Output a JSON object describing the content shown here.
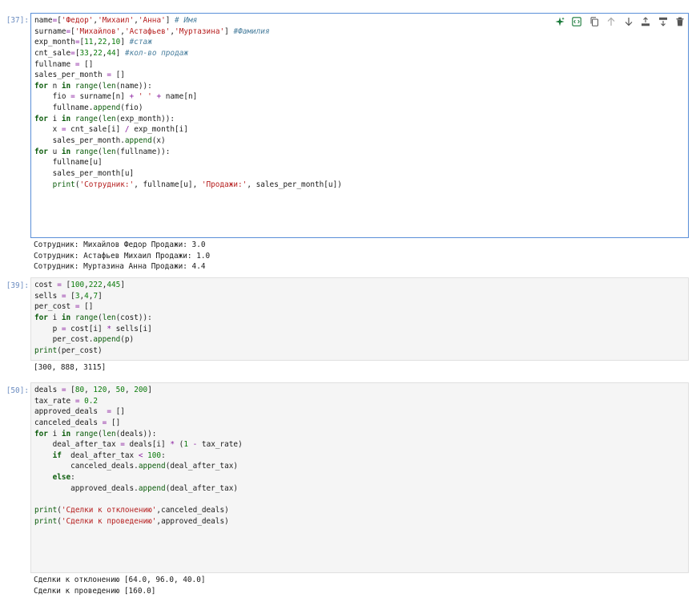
{
  "cells": [
    {
      "prompt": "[37]:",
      "lines": [
        "name=['Федор','Михаил','Анна'] # Имя",
        "surname=['Михайлов','Астафьев','Муртазина'] #Фамилия",
        "exp_month=[11,22,10] #стаж",
        "cnt_sale=[33,22,44] #кол-во продаж",
        "fullname = []",
        "sales_per_month = []",
        "for n in range(len(name)):",
        "    fio = surname[n] + ' ' + name[n]",
        "    fullname.append(fio)",
        "for i in range(len(exp_month)):",
        "    x = cnt_sale[i] / exp_month[i]",
        "    sales_per_month.append(x)",
        "for u in range(len(fullname)):",
        "    fullname[u]",
        "    sales_per_month[u]",
        "    print('Сотрудник:', fullname[u], 'Продажи:', sales_per_month[u])"
      ],
      "output": [
        "Сотрудник: Михайлов Федор Продажи: 3.0",
        "Сотрудник: Астафьев Михаил Продажи: 1.0",
        "Сотрудник: Муртазина Анна Продажи: 4.4"
      ]
    },
    {
      "prompt": "[39]:",
      "lines": [
        "cost = [100,222,445]",
        "sells = [3,4,7]",
        "per_cost = []",
        "for i in range(len(cost)):",
        "    p = cost[i] * sells[i]",
        "    per_cost.append(p)",
        "print(per_cost)"
      ],
      "output": [
        "[300, 888, 3115]"
      ]
    },
    {
      "prompt": "[50]:",
      "lines": [
        "deals = [80, 120, 50, 200]",
        "tax_rate = 0.2",
        "approved_deals  = []",
        "canceled_deals = []",
        "for i in range(len(deals)):",
        "    deal_after_tax = deals[i] * (1 - tax_rate)",
        "    if  deal_after_tax < 100:",
        "        canceled_deals.append(deal_after_tax)",
        "    else:",
        "        approved_deals.append(deal_after_tax)",
        "",
        "print('Сделки к отклонению',canceled_deals)",
        "print('Сделки к проведению',approved_deals)"
      ],
      "output": [
        "Сделки к отклонению [64.0, 96.0, 40.0]",
        "Сделки к проведению [160.0]"
      ]
    }
  ],
  "toolbar_icons": [
    {
      "name": "sparkle-icon"
    },
    {
      "name": "code-icon"
    },
    {
      "name": "copy-icon"
    },
    {
      "name": "arrow-up-icon"
    },
    {
      "name": "arrow-down-icon"
    },
    {
      "name": "insert-above-icon"
    },
    {
      "name": "insert-below-icon"
    },
    {
      "name": "delete-icon"
    }
  ],
  "colors": {
    "accent": "#5a8fd8",
    "prompt": "#6b8cc0",
    "keyword": "#0b5c0b",
    "string": "#b51d1d",
    "comment": "#4a7f9e"
  }
}
